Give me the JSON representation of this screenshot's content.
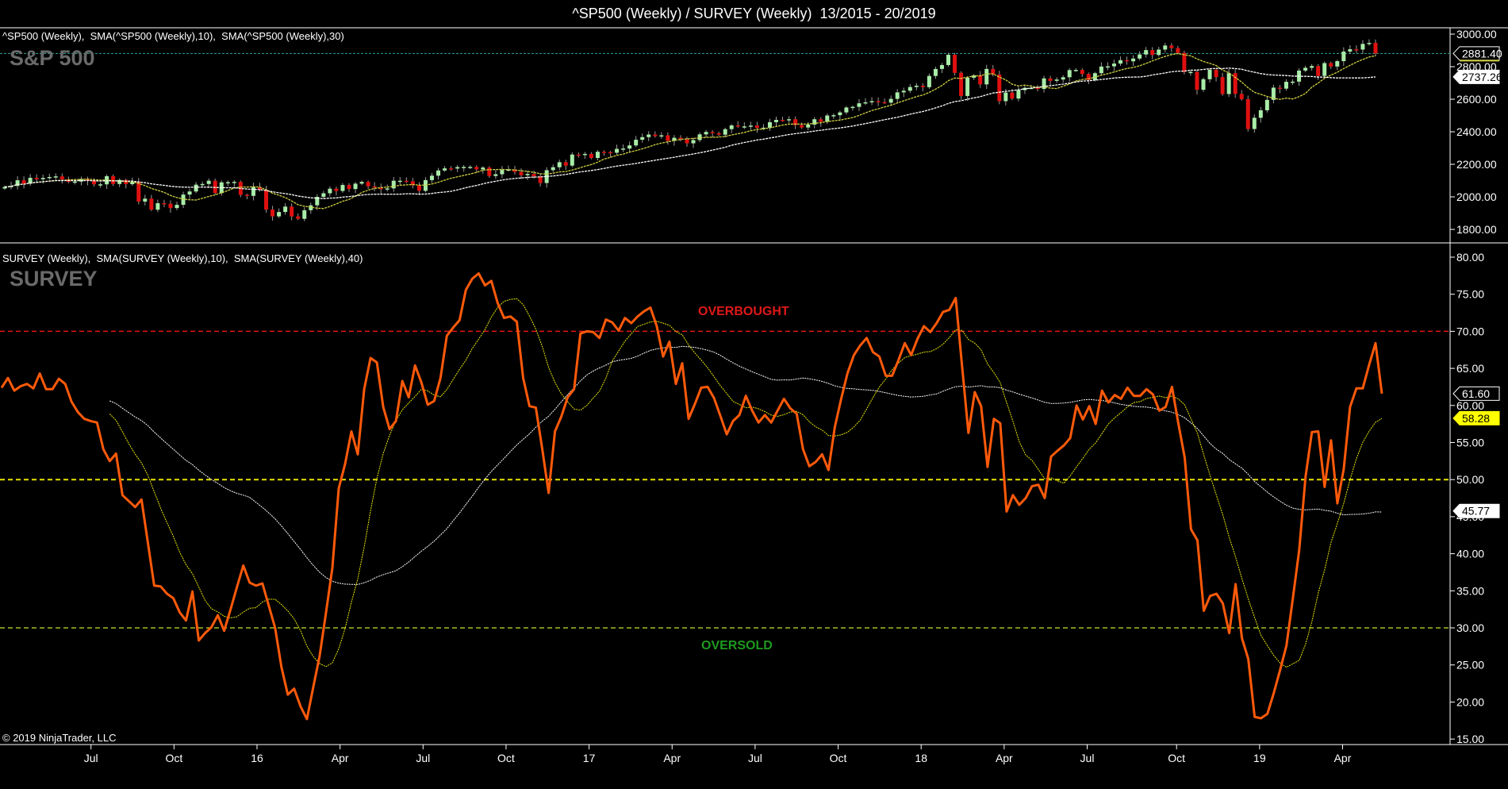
{
  "title": "^SP500 (Weekly) / SURVEY (Weekly)  13/2015 - 20/2019",
  "copyright": "© 2019 NinjaTrader, LLC",
  "colors": {
    "background": "#000000",
    "candle_up": "#a8ecA8",
    "candle_down": "#e01010",
    "sp_sma10": "#d0d040",
    "sp_sma30": "#ffffff",
    "last_price_line": "#2aa89a",
    "survey_line": "#ff5a0a",
    "survey_sma10": "#e6e600",
    "survey_sma40": "#ffffff",
    "overbought": "#e01818",
    "midline": "#e6e600",
    "oversold": "#a0c020",
    "overbought_text": "#e01818",
    "oversold_text": "#1e9a1e"
  },
  "chart_data": [
    {
      "type": "candlestick",
      "panel": "top",
      "legend": "^SP500 (Weekly),  SMA(^SP500 (Weekly),10),  SMA(^SP500 (Weekly),30)",
      "watermark": "S&P 500",
      "start_week": "13/2015",
      "end_week": "20/2019",
      "ylim": [
        1750,
        3040
      ],
      "yticks": [
        "1800.00",
        "2000.00",
        "2200.00",
        "2400.00",
        "2600.00",
        "2800.00",
        "3000.00"
      ],
      "sma_periods": [
        10,
        30
      ],
      "last_labels": {
        "price": "2881.40",
        "sma30": "2737.26"
      },
      "close": [
        2061,
        2067,
        2102,
        2081,
        2117,
        2108,
        2116,
        2122,
        2126,
        2107,
        2092,
        2094,
        2110,
        2101,
        2077,
        2077,
        2127,
        2079,
        2104,
        2078,
        2092,
        1971,
        1989,
        1921,
        1961,
        1958,
        1931,
        1951,
        2014,
        2033,
        2075,
        2079,
        2099,
        2023,
        2089,
        2090,
        2092,
        2012,
        2006,
        2061,
        2044,
        1922,
        1880,
        1907,
        1940,
        1880,
        1865,
        1918,
        1948,
        2000,
        2022,
        2050,
        2036,
        2073,
        2048,
        2081,
        2092,
        2065,
        2057,
        2047,
        2052,
        2099,
        2099,
        2096,
        2071,
        2037,
        2103,
        2130,
        2162,
        2175,
        2174,
        2183,
        2184,
        2184,
        2169,
        2180,
        2128,
        2139,
        2165,
        2168,
        2153,
        2133,
        2141,
        2126,
        2085,
        2164,
        2182,
        2213,
        2192,
        2260,
        2258,
        2264,
        2239,
        2277,
        2275,
        2271,
        2295,
        2297,
        2316,
        2351,
        2367,
        2383,
        2373,
        2378,
        2344,
        2363,
        2355,
        2329,
        2349,
        2384,
        2399,
        2391,
        2382,
        2416,
        2439,
        2432,
        2433,
        2438,
        2423,
        2425,
        2459,
        2473,
        2472,
        2477,
        2441,
        2426,
        2444,
        2477,
        2461,
        2500,
        2502,
        2519,
        2549,
        2553,
        2575,
        2581,
        2588,
        2582,
        2579,
        2602,
        2642,
        2652,
        2675,
        2683,
        2674,
        2743,
        2786,
        2810,
        2873,
        2762,
        2620,
        2732,
        2747,
        2691,
        2786,
        2752,
        2588,
        2641,
        2604,
        2656,
        2670,
        2670,
        2663,
        2728,
        2713,
        2721,
        2735,
        2779,
        2780,
        2755,
        2718,
        2760,
        2801,
        2802,
        2819,
        2840,
        2833,
        2850,
        2875,
        2902,
        2872,
        2905,
        2930,
        2914,
        2885,
        2767,
        2768,
        2658,
        2723,
        2781,
        2736,
        2632,
        2760,
        2633,
        2600,
        2417,
        2486,
        2532,
        2596,
        2671,
        2665,
        2707,
        2708,
        2776,
        2793,
        2804,
        2743,
        2822,
        2801,
        2834,
        2893,
        2907,
        2905,
        2940,
        2946,
        2881.4
      ]
    },
    {
      "type": "line",
      "panel": "bottom",
      "legend": "SURVEY (Weekly),  SMA(SURVEY (Weekly),10),  SMA(SURVEY (Weekly),40)",
      "watermark": "SURVEY",
      "start_week": "13/2015",
      "end_week": "20/2019",
      "ylim": [
        15,
        80
      ],
      "yticks": [
        "15.00",
        "20.00",
        "25.00",
        "30.00",
        "35.00",
        "40.00",
        "45.00",
        "50.00",
        "55.00",
        "60.00",
        "65.00",
        "70.00",
        "75.00",
        "80.00"
      ],
      "sma_periods": [
        10,
        40
      ],
      "levels": [
        {
          "value": 70,
          "label": "OVERBOUGHT"
        },
        {
          "value": 50,
          "label": ""
        },
        {
          "value": 30,
          "label": "OVERSOLD"
        }
      ],
      "last_labels": {
        "value": "61.60",
        "sma10": "58.28",
        "sma40": "45.77"
      },
      "values": [
        62.4,
        63.7,
        62.0,
        62.6,
        62.9,
        62.3,
        64.3,
        62.2,
        62.2,
        63.6,
        62.9,
        60.5,
        59.1,
        58.2,
        57.9,
        57.7,
        54.1,
        52.5,
        53.5,
        47.9,
        47.1,
        46.3,
        47.3,
        41.5,
        35.7,
        35.6,
        34.6,
        34.0,
        32.1,
        31.0,
        34.9,
        28.3,
        29.3,
        30.1,
        31.7,
        29.6,
        32.5,
        35.5,
        38.4,
        36.1,
        35.7,
        36.0,
        33.0,
        30.0,
        24.7,
        21.0,
        21.8,
        19.4,
        17.7,
        22.0,
        26.2,
        32.0,
        38.1,
        48.8,
        52.1,
        56.5,
        53.4,
        62.2,
        66.4,
        65.8,
        59.8,
        56.8,
        57.9,
        63.3,
        61.1,
        65.4,
        63.1,
        60.1,
        60.6,
        63.7,
        69.4,
        70.5,
        71.5,
        75.6,
        77.1,
        77.8,
        76.2,
        76.8,
        73.8,
        71.8,
        72.0,
        71.3,
        63.7,
        59.9,
        59.7,
        54.1,
        48.2,
        56.5,
        58.5,
        61.1,
        62.2,
        69.7,
        70.0,
        69.9,
        69.1,
        71.6,
        71.2,
        70.1,
        71.8,
        71.1,
        72.0,
        72.7,
        73.2,
        70.7,
        66.6,
        68.6,
        62.9,
        65.7,
        58.2,
        60.2,
        62.4,
        62.5,
        61.0,
        58.6,
        56.1,
        57.9,
        58.7,
        61.3,
        59.3,
        57.7,
        58.7,
        57.7,
        59.3,
        60.9,
        59.6,
        58.9,
        54.1,
        51.8,
        52.4,
        53.4,
        51.3,
        57.1,
        60.9,
        64.4,
        66.8,
        68.1,
        69.1,
        67.2,
        66.6,
        64.0,
        64.0,
        66.1,
        68.4,
        66.8,
        69.0,
        70.7,
        69.9,
        71.1,
        72.6,
        72.9,
        74.5,
        65.3,
        56.3,
        61.8,
        59.9,
        51.7,
        58.2,
        57.6,
        45.7,
        47.9,
        46.6,
        47.5,
        49.1,
        49.3,
        47.5,
        53.1,
        53.9,
        54.6,
        55.6,
        60.0,
        58.1,
        59.9,
        57.5,
        62.0,
        60.4,
        61.4,
        60.9,
        62.4,
        61.3,
        61.3,
        62.2,
        61.5,
        59.3,
        59.8,
        62.5,
        57.6,
        53.0,
        43.3,
        41.8,
        32.3,
        34.3,
        34.6,
        33.3,
        29.3,
        35.9,
        28.6,
        25.8,
        18.0,
        17.8,
        18.4,
        21.2,
        24.3,
        27.6,
        33.9,
        40.5,
        50.4,
        56.4,
        56.5,
        49.0,
        55.3,
        46.8,
        51.4,
        59.8,
        62.3,
        62.3,
        65.5,
        68.4,
        61.6
      ]
    }
  ],
  "x_axis": {
    "ticks": [
      {
        "label": "Jul",
        "date": "2015-07-03"
      },
      {
        "label": "Oct",
        "date": "2015-10-02"
      },
      {
        "label": "16",
        "date": "2016-01-01"
      },
      {
        "label": "Apr",
        "date": "2016-04-01"
      },
      {
        "label": "Jul",
        "date": "2016-07-01"
      },
      {
        "label": "Oct",
        "date": "2016-09-30"
      },
      {
        "label": "17",
        "date": "2016-12-30"
      },
      {
        "label": "Apr",
        "date": "2017-03-31"
      },
      {
        "label": "Jul",
        "date": "2017-06-30"
      },
      {
        "label": "Oct",
        "date": "2017-09-29"
      },
      {
        "label": "18",
        "date": "2017-12-29"
      },
      {
        "label": "Apr",
        "date": "2018-03-30"
      },
      {
        "label": "Jul",
        "date": "2018-06-29"
      },
      {
        "label": "Oct",
        "date": "2018-10-05"
      },
      {
        "label": "19",
        "date": "2019-01-04"
      },
      {
        "label": "Apr",
        "date": "2019-04-05"
      }
    ]
  }
}
